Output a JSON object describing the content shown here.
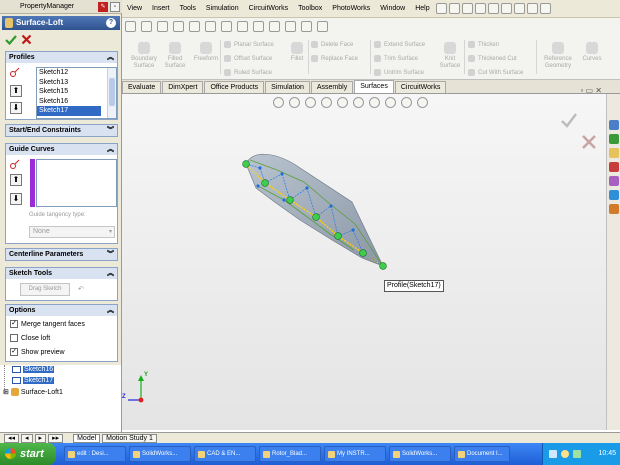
{
  "app": {
    "title": "SolidWorks"
  },
  "menubar": {
    "items": [
      "View",
      "Insert",
      "Tools",
      "Simulation",
      "CircuitWorks",
      "Toolbox",
      "PhotoWorks",
      "Window",
      "Help"
    ]
  },
  "ribbon": {
    "boundary_surface": "Boundary Surface",
    "filled_surface": "Filled Surface",
    "freeform": "Freeform",
    "planar_surface": "Planar Surface",
    "offset_surface": "Offset Surface",
    "ruled_surface": "Ruled Surface",
    "fillet": "Fillet",
    "delete_face": "Delete Face",
    "replace_face": "Replace Face",
    "extend_surface": "Extend Surface",
    "trim_surface": "Trim Surface",
    "untrim_surface": "Untrim Surface",
    "knit_surface": "Knit Surface",
    "thicken": "Thicken",
    "thickened_cut": "Thickened Cut",
    "cut_with_surface": "Cut With Surface",
    "reference_geometry": "Reference Geometry",
    "curves": "Curves"
  },
  "tabs": [
    "Evaluate",
    "DimXpert",
    "Office Products",
    "Simulation",
    "Assembly",
    "Surfaces",
    "CircuitWorks"
  ],
  "active_tab": "Surfaces",
  "property_manager": {
    "title": "PropertyManager",
    "feature_title": "Surface-Loft",
    "help": "?",
    "profiles": {
      "header": "Profiles",
      "items": [
        "Sketch12",
        "Sketch13",
        "Sketch15",
        "Sketch16",
        "Sketch17"
      ],
      "selected": "Sketch17"
    },
    "start_end_constraints": "Start/End Constraints",
    "guide_curves": {
      "header": "Guide Curves",
      "tangency_label": "Guide tangency type:",
      "tangency_value": "None"
    },
    "centerline_parameters": "Centerline Parameters",
    "sketch_tools": {
      "header": "Sketch Tools",
      "drag_sketch": "Drag Sketch"
    },
    "options": {
      "header": "Options",
      "merge_tangent_faces": {
        "label": "Merge tangent faces",
        "checked": true
      },
      "close_loft": {
        "label": "Close loft",
        "checked": false
      },
      "show_preview": {
        "label": "Show preview",
        "checked": true
      }
    }
  },
  "tree": {
    "items": [
      "Sketch16",
      "Sketch17",
      "Surface-Loft1"
    ]
  },
  "viewport": {
    "callout": "Profile(Sketch17)",
    "triad_y": "Y",
    "triad_z": "Z"
  },
  "bottom_tabs": [
    "Model",
    "Motion Study 1"
  ],
  "taskbar": {
    "start": "start",
    "items": [
      "edit : Desi...",
      "SolidWorks...",
      "CAD & EN...",
      "Rotor_Blad...",
      "My INSTR...",
      "SolidWorks...",
      "Document I..."
    ],
    "clock": "10:45"
  },
  "colors": {
    "accent": "#1f5ed6",
    "loft": "#2a7be0",
    "preview": "#5a9e3a",
    "guide": "#ffd200",
    "selection": "#316ac5"
  }
}
